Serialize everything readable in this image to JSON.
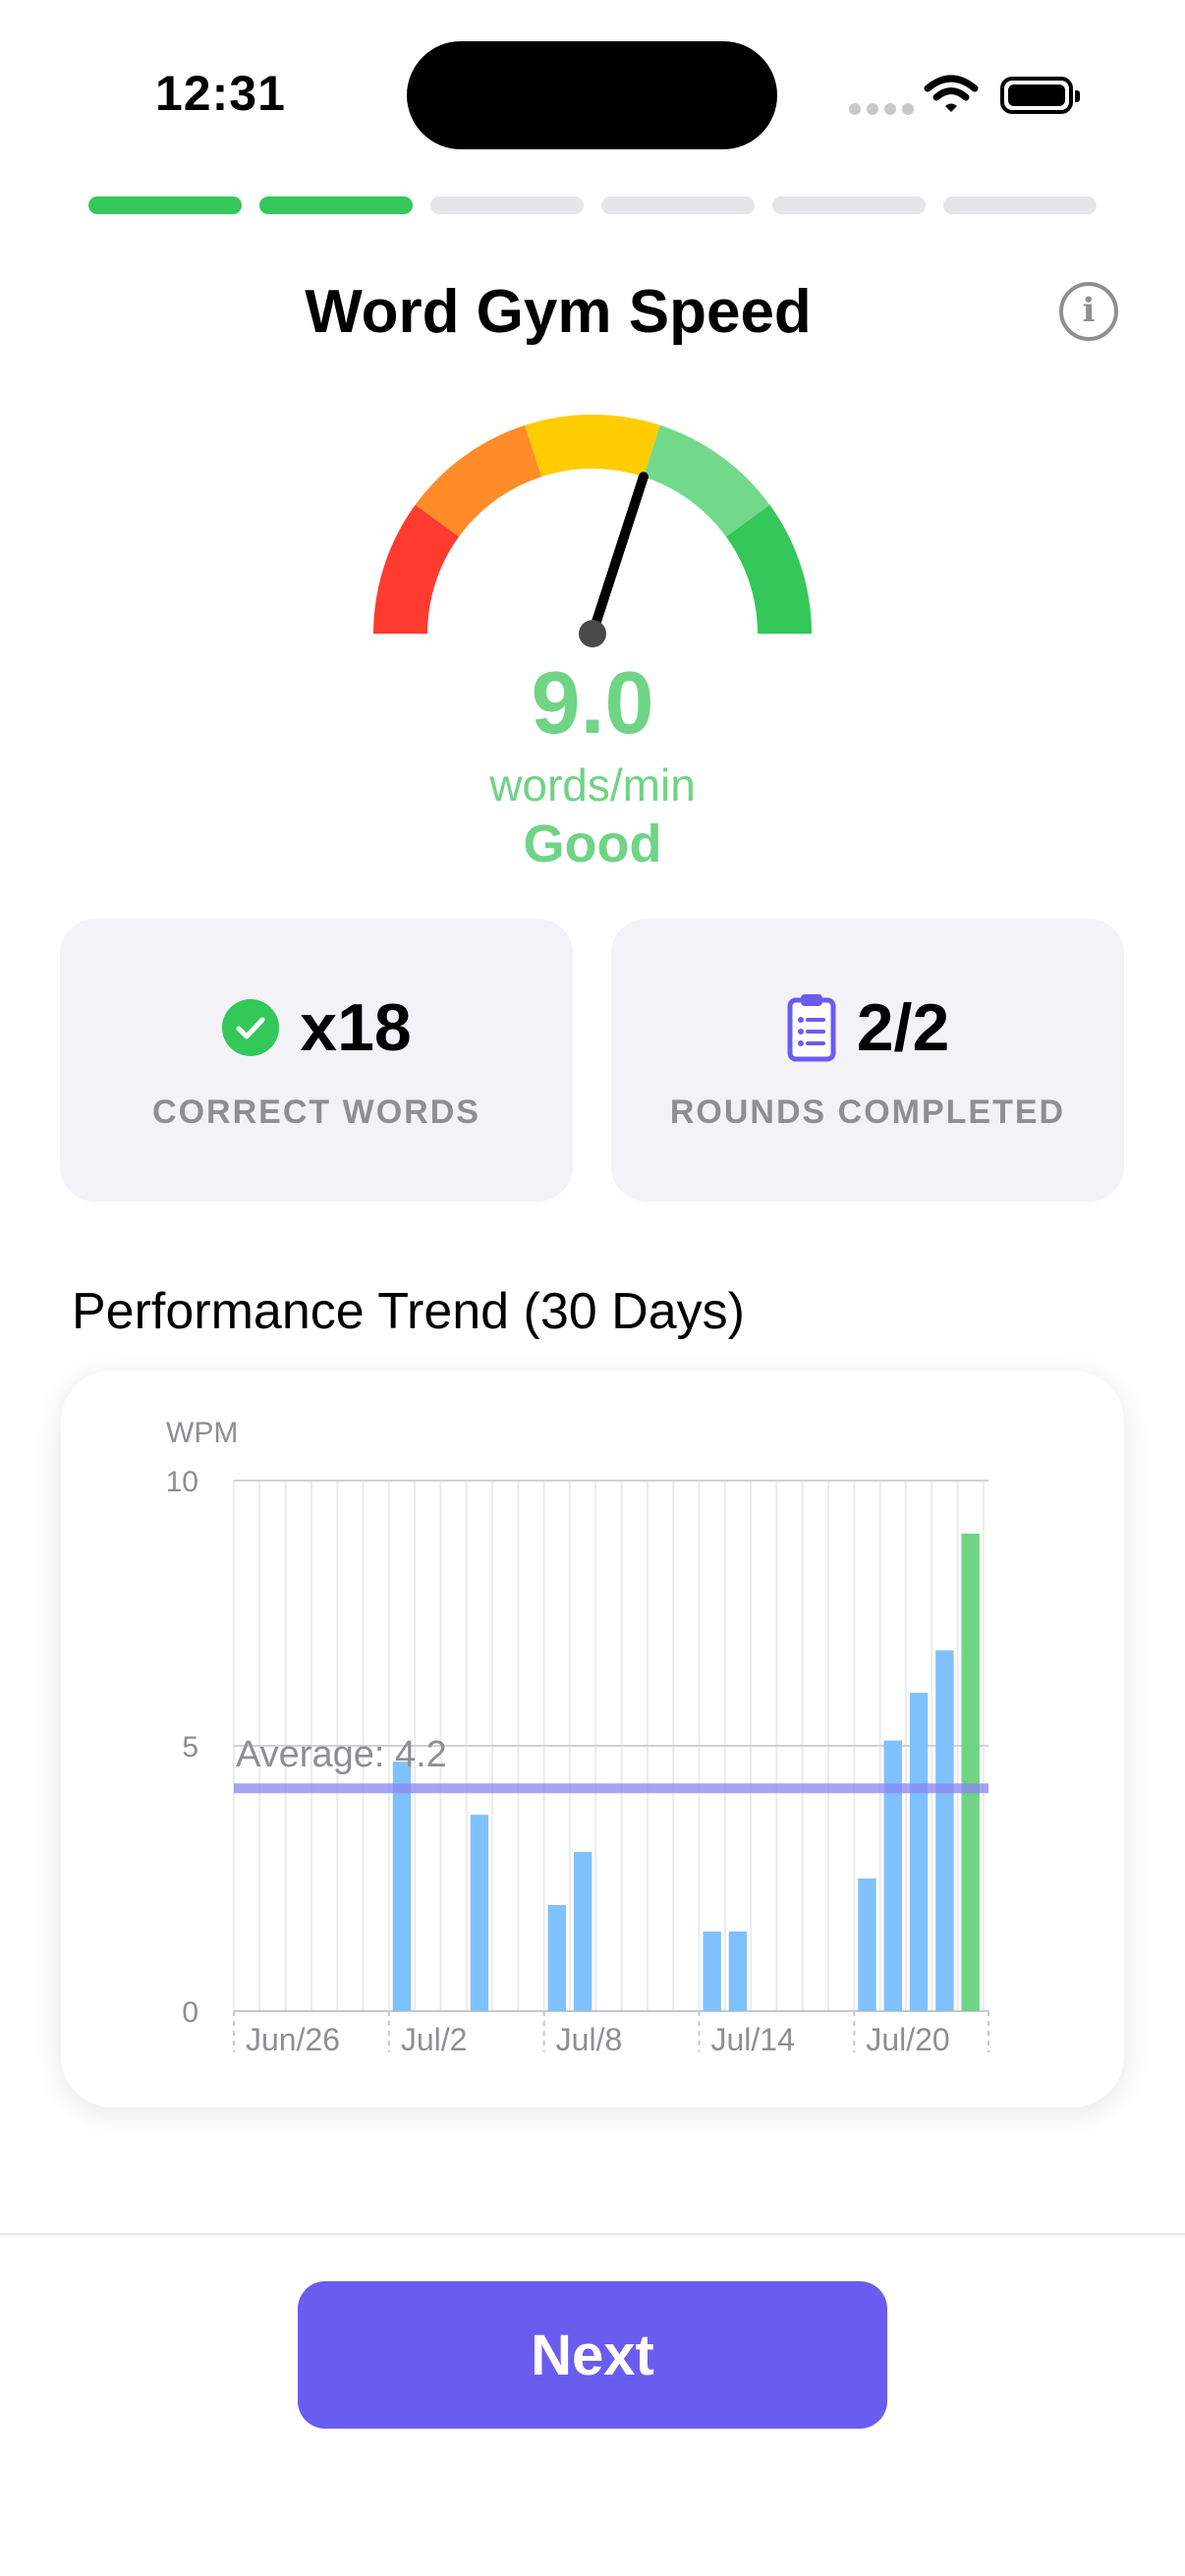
{
  "status_bar": {
    "time": "12:31"
  },
  "progress": {
    "total_steps": 6,
    "completed_steps": 2
  },
  "header": {
    "title": "Word Gym Speed"
  },
  "gauge": {
    "value": "9.0",
    "unit": "words/min",
    "rating": "Good",
    "needle_fraction": 0.6
  },
  "stats": {
    "correct": {
      "value": "x18",
      "label": "CORRECT WORDS",
      "icon": "checkmark-circle-icon"
    },
    "rounds": {
      "value": "2/2",
      "label": "ROUNDS COMPLETED",
      "icon": "clipboard-list-icon"
    }
  },
  "trend": {
    "title": "Performance Trend (30 Days)"
  },
  "chart_data": {
    "type": "bar",
    "ylabel": "WPM",
    "ylim": [
      0,
      10
    ],
    "yticks": [
      0,
      5,
      10
    ],
    "x_tick_labels": [
      "Jun/26",
      "Jul/2",
      "Jul/8",
      "Jul/14",
      "Jul/20"
    ],
    "x_tick_day_index": [
      0,
      6,
      12,
      18,
      24
    ],
    "average": {
      "label": "Average: 4.2",
      "value": 4.2
    },
    "days": [
      "Jun/26",
      "Jun/27",
      "Jun/28",
      "Jun/29",
      "Jun/30",
      "Jul/1",
      "Jul/2",
      "Jul/3",
      "Jul/4",
      "Jul/5",
      "Jul/6",
      "Jul/7",
      "Jul/8",
      "Jul/9",
      "Jul/10",
      "Jul/11",
      "Jul/12",
      "Jul/13",
      "Jul/14",
      "Jul/15",
      "Jul/16",
      "Jul/17",
      "Jul/18",
      "Jul/19",
      "Jul/20",
      "Jul/21",
      "Jul/22",
      "Jul/23",
      "Jul/24",
      "Jul/25"
    ],
    "values": [
      0,
      0,
      0,
      0,
      0,
      0,
      4.7,
      0,
      0,
      3.7,
      0,
      0,
      2.0,
      3.0,
      0,
      0,
      0,
      0,
      1.5,
      1.5,
      0,
      0,
      0,
      0,
      2.5,
      5.1,
      6.0,
      6.8,
      9.0,
      0
    ],
    "highlight_index": 28,
    "colors": {
      "bar": "#7fc1ff",
      "highlight": "#6fd485",
      "average": "#8a85f2"
    }
  },
  "footer": {
    "next_label": "Next"
  }
}
